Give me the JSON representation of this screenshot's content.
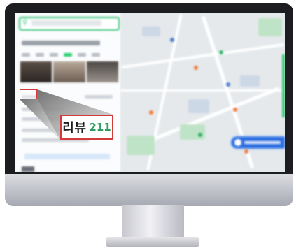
{
  "review_callout": {
    "label": "리뷰",
    "count": "211"
  },
  "colors": {
    "callout_border": "#d33a3a",
    "count_accent": "#2f9e63",
    "search_accent": "#36c27a",
    "map_button": "#2f6fe0"
  },
  "icons": [
    "search-icon",
    "monitor-device"
  ]
}
